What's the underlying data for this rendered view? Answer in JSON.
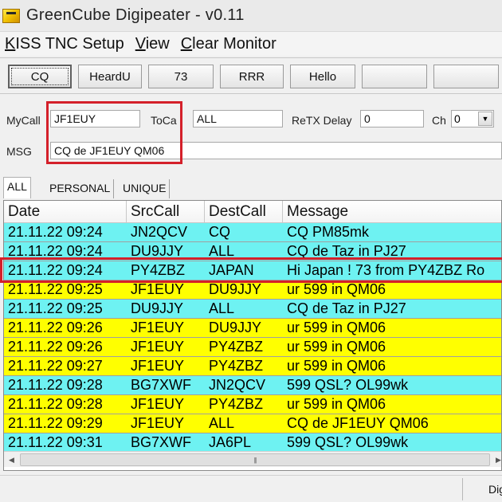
{
  "window": {
    "title": "GreenCube Digipeater - v0.11"
  },
  "menu": {
    "items": [
      {
        "label_ul": "K",
        "label_rest": "ISS TNC Setup"
      },
      {
        "label_ul": "V",
        "label_rest": "iew"
      },
      {
        "label_ul": "C",
        "label_rest": "lear Monitor"
      }
    ]
  },
  "toolbar": {
    "buttons": [
      "CQ",
      "HeardU",
      "73",
      "RRR",
      "Hello",
      "",
      ""
    ]
  },
  "form": {
    "mycall_label": "MyCall",
    "mycall_value": "JF1EUY",
    "tocall_label": "ToCa",
    "tocall_value": "ALL",
    "retx_label": "ReTX Delay",
    "retx_value": "0",
    "ch_label": "Ch",
    "ch_value": "0",
    "msg_label": "MSG",
    "msg_value": "CQ de  JF1EUY QM06"
  },
  "tabs": [
    "ALL",
    "PERSONAL",
    "UNIQUE"
  ],
  "table": {
    "columns": [
      "Date",
      "SrcCall",
      "DestCall",
      "Message"
    ],
    "rows": [
      {
        "date": "21.11.22 09:24",
        "src": "JN2QCV",
        "dest": "CQ",
        "msg": "CQ PM85mk",
        "color": "cyan"
      },
      {
        "date": "21.11.22 09:24",
        "src": "DU9JJY",
        "dest": "ALL",
        "msg": "CQ de Taz in PJ27",
        "color": "cyan"
      },
      {
        "date": "21.11.22 09:24",
        "src": "PY4ZBZ",
        "dest": "JAPAN",
        "msg": "Hi Japan ! 73 from PY4ZBZ Ro",
        "color": "cyan"
      },
      {
        "date": "21.11.22 09:25",
        "src": "JF1EUY",
        "dest": "DU9JJY",
        "msg": "ur 599 in QM06",
        "color": "yellow"
      },
      {
        "date": "21.11.22 09:25",
        "src": "DU9JJY",
        "dest": "ALL",
        "msg": "CQ de Taz in PJ27",
        "color": "cyan"
      },
      {
        "date": "21.11.22 09:26",
        "src": "JF1EUY",
        "dest": "DU9JJY",
        "msg": "ur 599 in QM06",
        "color": "yellow"
      },
      {
        "date": "21.11.22 09:26",
        "src": "JF1EUY",
        "dest": "PY4ZBZ",
        "msg": "ur 599 in QM06",
        "color": "yellow"
      },
      {
        "date": "21.11.22 09:27",
        "src": "JF1EUY",
        "dest": "PY4ZBZ",
        "msg": "ur 599 in QM06",
        "color": "yellow"
      },
      {
        "date": "21.11.22 09:28",
        "src": "BG7XWF",
        "dest": "JN2QCV",
        "msg": "599 QSL? OL99wk",
        "color": "cyan"
      },
      {
        "date": "21.11.22 09:28",
        "src": "JF1EUY",
        "dest": "PY4ZBZ",
        "msg": "ur 599 in QM06",
        "color": "yellow"
      },
      {
        "date": "21.11.22 09:29",
        "src": "JF1EUY",
        "dest": "ALL",
        "msg": "CQ de  JF1EUY QM06",
        "color": "yellow"
      },
      {
        "date": "21.11.22 09:31",
        "src": "BG7XWF",
        "dest": "JA6PL",
        "msg": "599 QSL? OL99wk",
        "color": "cyan"
      }
    ]
  },
  "statusbar": {
    "text": "Dig"
  },
  "colors": {
    "highlight_box": "#d4202a",
    "row_cyan": "#6ef2f2",
    "row_yellow": "#ffff00"
  }
}
